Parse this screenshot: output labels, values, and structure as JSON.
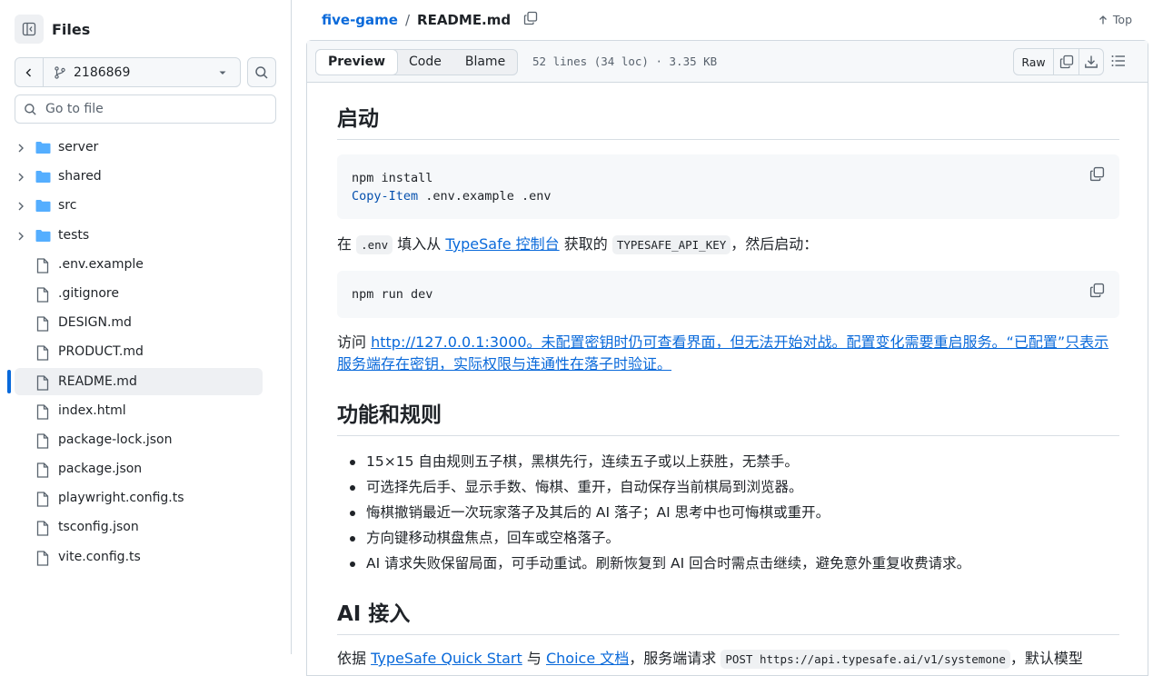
{
  "sidebar": {
    "title": "Files",
    "branch": "2186869",
    "goto_placeholder": "Go to file",
    "items": [
      {
        "label": "server",
        "type": "folder"
      },
      {
        "label": "shared",
        "type": "folder"
      },
      {
        "label": "src",
        "type": "folder"
      },
      {
        "label": "tests",
        "type": "folder"
      },
      {
        "label": ".env.example",
        "type": "file"
      },
      {
        "label": ".gitignore",
        "type": "file"
      },
      {
        "label": "DESIGN.md",
        "type": "file"
      },
      {
        "label": "PRODUCT.md",
        "type": "file"
      },
      {
        "label": "README.md",
        "type": "file",
        "active": true
      },
      {
        "label": "index.html",
        "type": "file"
      },
      {
        "label": "package-lock.json",
        "type": "file"
      },
      {
        "label": "package.json",
        "type": "file"
      },
      {
        "label": "playwright.config.ts",
        "type": "file"
      },
      {
        "label": "tsconfig.json",
        "type": "file"
      },
      {
        "label": "vite.config.ts",
        "type": "file"
      }
    ]
  },
  "header": {
    "repo": "five-game",
    "separator": "/",
    "file": "README.md",
    "top_label": "Top"
  },
  "file_header": {
    "tabs": [
      "Preview",
      "Code",
      "Blame"
    ],
    "active_tab": "Preview",
    "meta": "52 lines (34 loc) · 3.35 KB",
    "raw_label": "Raw"
  },
  "content": {
    "h_start": "启动",
    "code1_line1": "npm install",
    "code1_kw": "Copy-Item",
    "code1_rest": " .env.example .env",
    "p1_a": "在 ",
    "p1_code1": ".env",
    "p1_b": " 填入从 ",
    "p1_link": "TypeSafe 控制台",
    "p1_c": " 获取的 ",
    "p1_code2": "TYPESAFE_API_KEY",
    "p1_d": "，然后启动：",
    "code2": "npm run dev",
    "p2_a": "访问 ",
    "p2_link": "http://127.0.0.1:3000。未配置密钥时仍可查看界面，但无法开始对战。配置变化需要重启服务。“已配置”只表示服务端存在密钥，实际权限与连通性在落子时验证。",
    "h_rules": "功能和规则",
    "rules": [
      "15×15 自由规则五子棋，黑棋先行，连续五子或以上获胜，无禁手。",
      "可选择先后手、显示手数、悔棋、重开，自动保存当前棋局到浏览器。",
      "悔棋撤销最近一次玩家落子及其后的 AI 落子；AI 思考中也可悔棋或重开。",
      "方向键移动棋盘焦点，回车或空格落子。",
      "AI 请求失败保留局面，可手动重试。刷新恢复到 AI 回合时需点击继续，避免意外重复收费请求。"
    ],
    "h_ai": "AI 接入",
    "p3_a": "依据 ",
    "p3_link1": "TypeSafe Quick Start",
    "p3_b": " 与 ",
    "p3_link2": "Choice 文档",
    "p3_c": "，服务端请求 ",
    "p3_code": "POST https://api.typesafe.ai/v1/systemone",
    "p3_d": "，默认模型"
  }
}
